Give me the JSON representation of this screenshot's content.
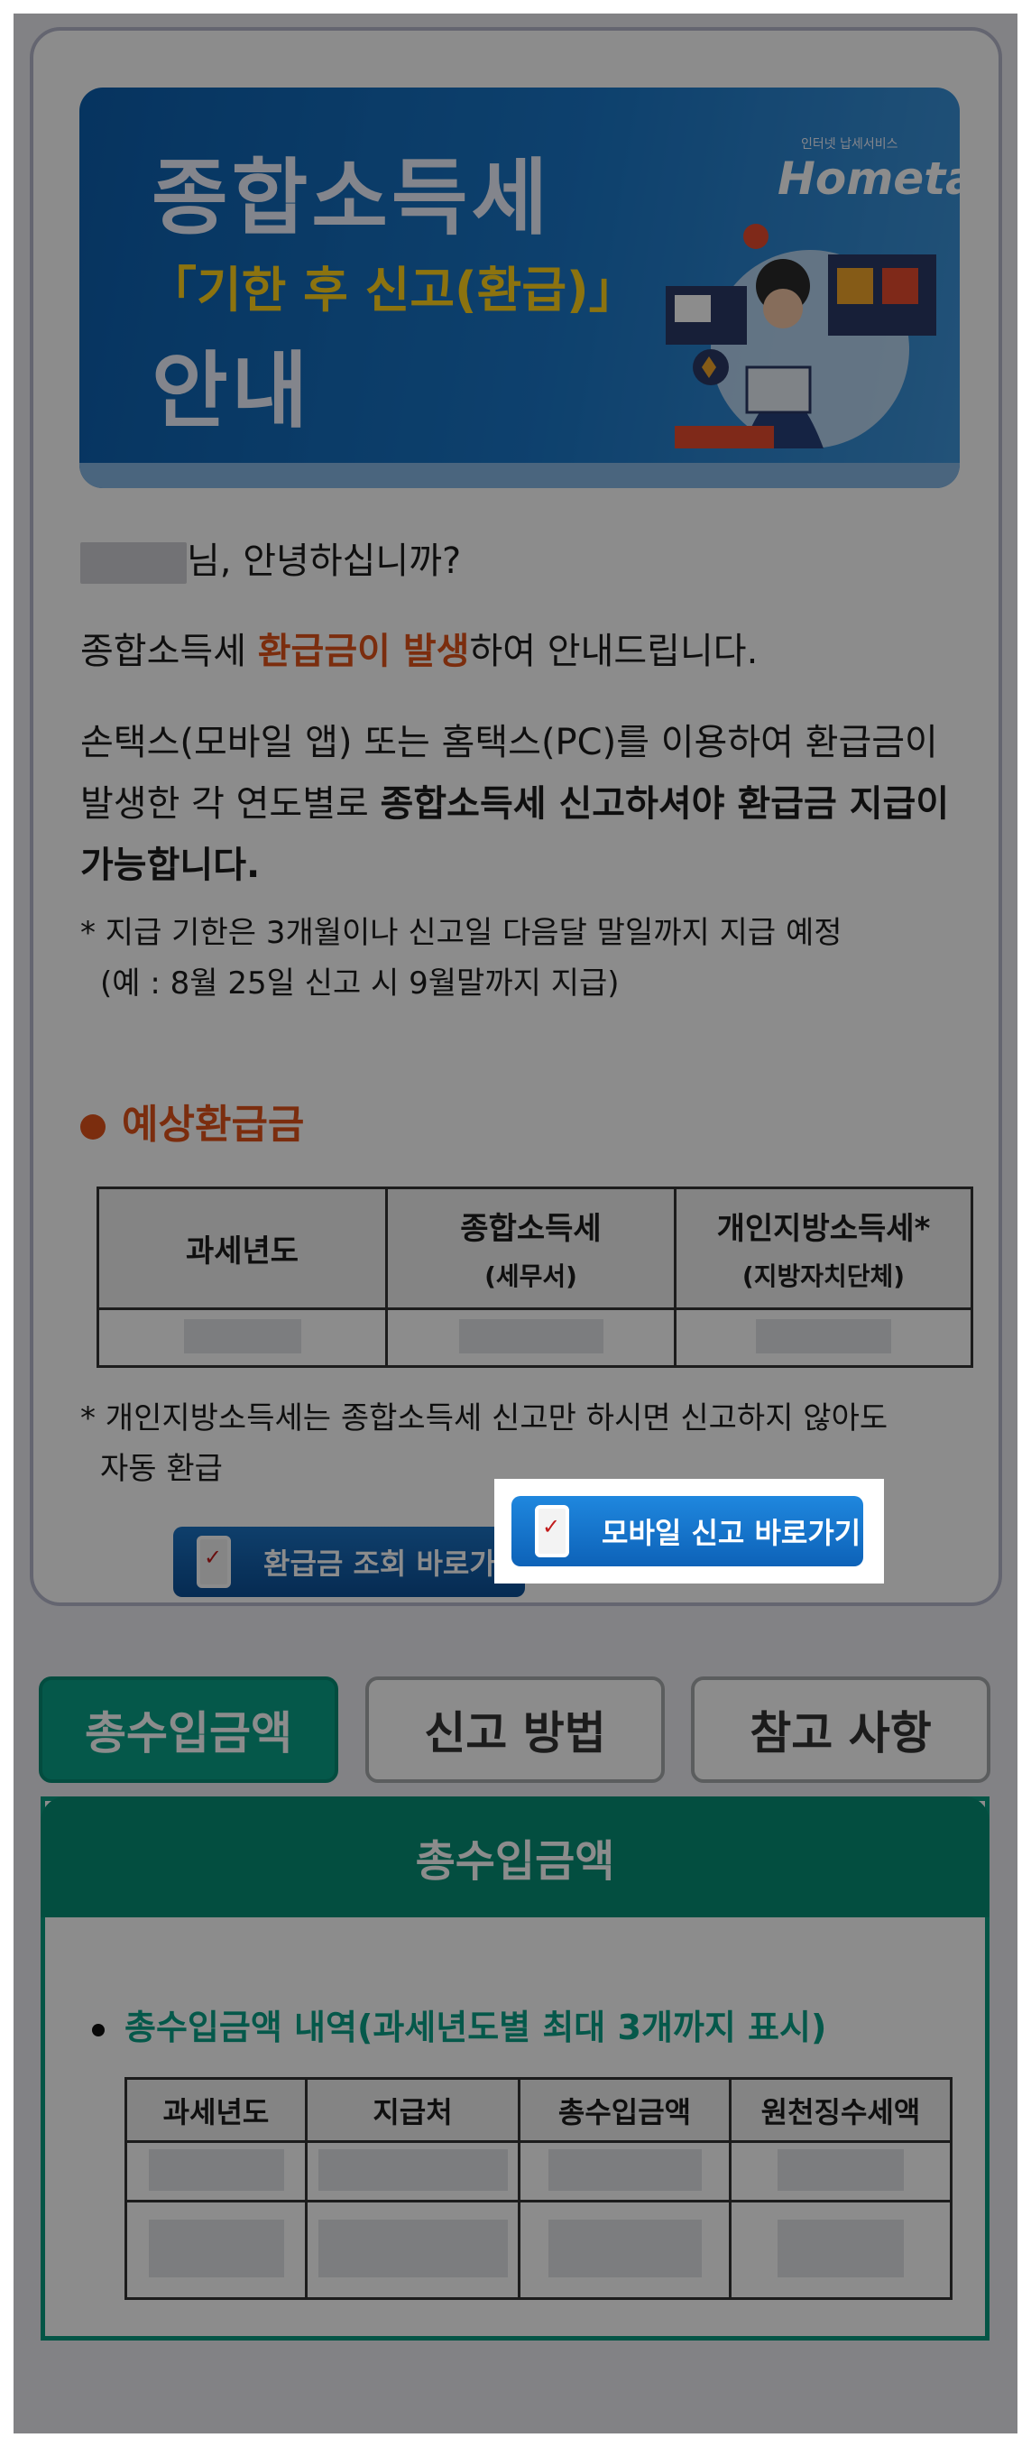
{
  "banner": {
    "title_line1": "종합소득세",
    "title_line2": "「기한 후 신고(환급)」",
    "title_line3": "안내",
    "logo_sub": "인터넷 납세서비스",
    "logo": "Hometax."
  },
  "greeting": "님, 안녕하십니까?",
  "para1": {
    "pre": "종합소득세 ",
    "highlight": "환급금이 발생",
    "post": "하여 안내드립니다."
  },
  "para2": {
    "pre": "손택스(모바일 앱) 또는 홈택스(PC)를 이용하여 환급금이 발생한 각 연도별로 ",
    "bold": "종합소득세 신고하셔야 환급금 지급이 가능합니다."
  },
  "note1": {
    "line1": "* 지급 기한은 3개월이나 신고일 다음달 말일까지 지급 예정",
    "line2": "(예 : 8월 25일 신고 시 9월말까지 지급)"
  },
  "refund_section": {
    "title": "예상환급금",
    "headers": [
      {
        "main": "과세년도",
        "sub": ""
      },
      {
        "main": "종합소득세",
        "sub": "(세무서)"
      },
      {
        "main": "개인지방소득세*",
        "sub": "(지방자치단체)"
      }
    ]
  },
  "note2": {
    "line1": "* 개인지방소득세는 종합소득세 신고만 하시면 신고하지 않아도",
    "line2": "자동 환급"
  },
  "buttons": {
    "query": "환급금 조회 바로가기",
    "mobile": "모바일 신고 바로가기"
  },
  "tabs": [
    "총수입금액",
    "신고 방법",
    "참고 사항"
  ],
  "panel": {
    "title": "총수입금액",
    "subtitle": "총수입금액 내역(과세년도별 최대 3개까지 표시)",
    "headers": [
      "과세년도",
      "지급처",
      "총수입금액",
      "원천징수세액"
    ]
  },
  "colors": {
    "accent_orange": "#e0531a",
    "accent_green": "#0aa088",
    "button_blue": "#1f87de"
  }
}
